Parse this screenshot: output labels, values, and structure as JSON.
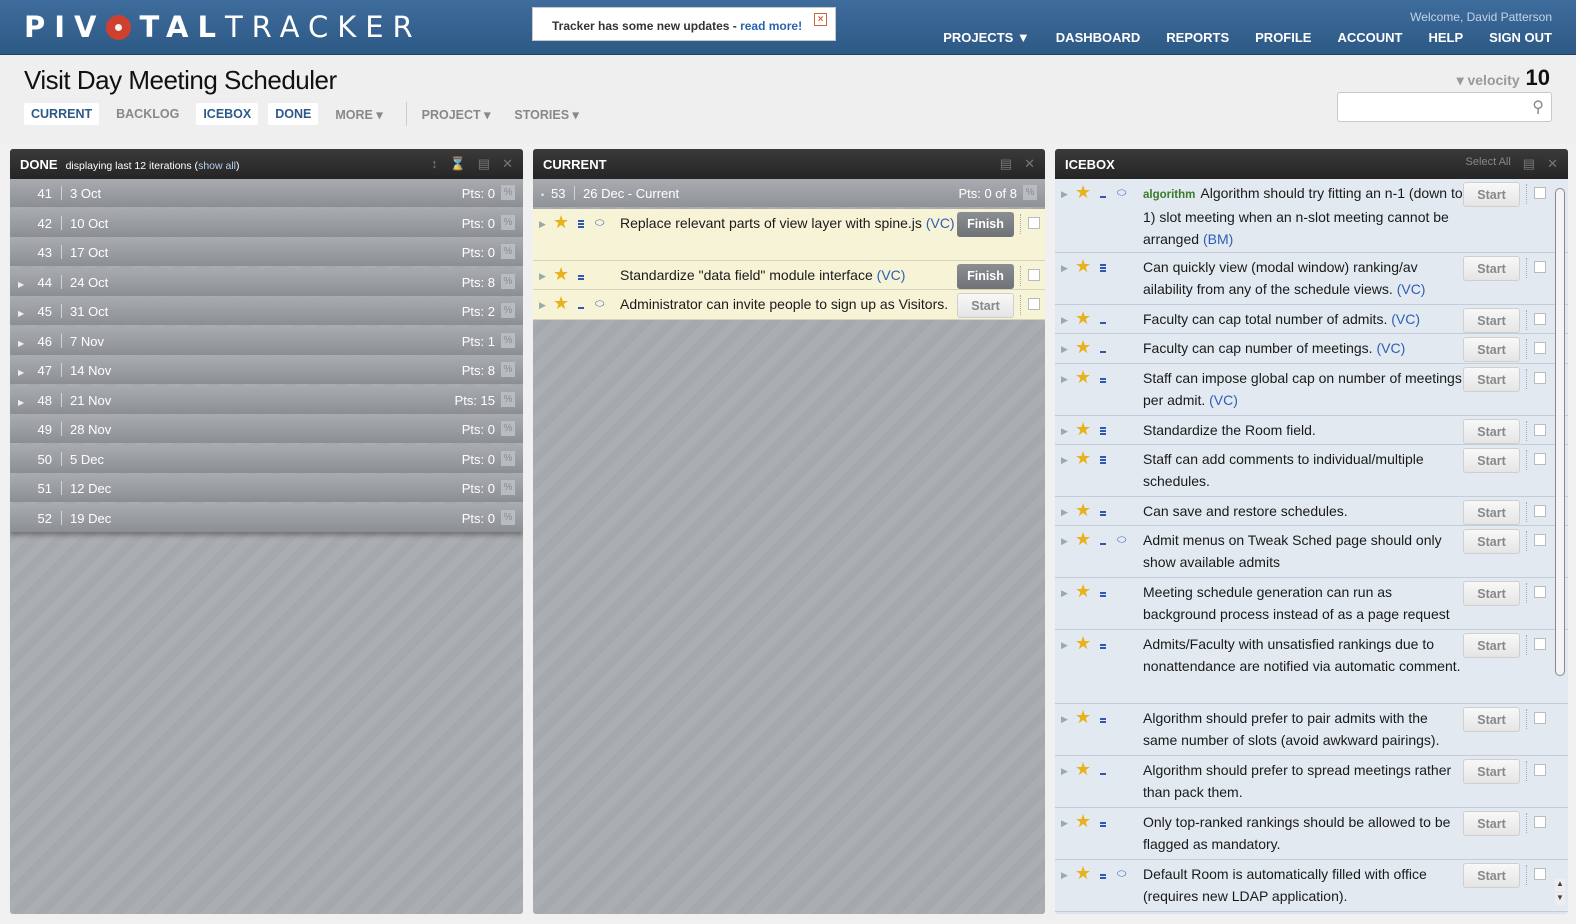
{
  "topbar": {
    "logo_part1": "PIV",
    "logo_part2": "TAL",
    "logo_part3": "TRACKER",
    "notice_text": "Tracker has some new updates - ",
    "notice_link": "read more!",
    "notice_close": "×",
    "welcome": "Welcome, David Patterson",
    "nav": [
      "PROJECTS ▼",
      "DASHBOARD",
      "REPORTS",
      "PROFILE",
      "ACCOUNT",
      "HELP",
      "SIGN OUT"
    ]
  },
  "header": {
    "title": "Visit Day Meeting Scheduler",
    "tabs": [
      "CURRENT",
      "BACKLOG",
      "ICEBOX",
      "DONE",
      "MORE ▾"
    ],
    "tabs2": [
      "PROJECT ▾",
      "STORIES ▾"
    ],
    "velocity_label": "▾ velocity",
    "velocity_value": "10"
  },
  "done": {
    "title": "DONE",
    "sub_prefix": "displaying last 12 iterations (",
    "sub_link": "show all",
    "sub_suffix": ")",
    "iterations": [
      {
        "num": "41",
        "date": "3 Oct",
        "pts": "Pts: 0",
        "expand": ""
      },
      {
        "num": "42",
        "date": "10 Oct",
        "pts": "Pts: 0",
        "expand": ""
      },
      {
        "num": "43",
        "date": "17 Oct",
        "pts": "Pts: 0",
        "expand": ""
      },
      {
        "num": "44",
        "date": "24 Oct",
        "pts": "Pts: 8",
        "expand": "▶"
      },
      {
        "num": "45",
        "date": "31 Oct",
        "pts": "Pts: 2",
        "expand": "▶"
      },
      {
        "num": "46",
        "date": "7 Nov",
        "pts": "Pts: 1",
        "expand": "▶"
      },
      {
        "num": "47",
        "date": "14 Nov",
        "pts": "Pts: 8",
        "expand": "▶"
      },
      {
        "num": "48",
        "date": "21 Nov",
        "pts": "Pts: 15",
        "expand": "▶"
      },
      {
        "num": "49",
        "date": "28 Nov",
        "pts": "Pts: 0",
        "expand": ""
      },
      {
        "num": "50",
        "date": "5 Dec",
        "pts": "Pts: 0",
        "expand": ""
      },
      {
        "num": "51",
        "date": "12 Dec",
        "pts": "Pts: 0",
        "expand": ""
      },
      {
        "num": "52",
        "date": "19 Dec",
        "pts": "Pts: 0",
        "expand": ""
      }
    ]
  },
  "current": {
    "title": "CURRENT",
    "iter_num": "53",
    "iter_date": "26 Dec - Current",
    "iter_pts": "Pts: 0 of 8",
    "stories": [
      {
        "text": "Replace relevant parts of view layer with spine.js ",
        "owner": "(VC)",
        "button": "Finish"
      },
      {
        "text": "Standardize \"data field\" module interface ",
        "owner": "(VC)",
        "button": "Finish"
      },
      {
        "text": "Administrator can invite people to sign up as Visitors.",
        "owner": "",
        "button": "Start"
      }
    ]
  },
  "icebox": {
    "title": "ICEBOX",
    "select_all": "Select All",
    "stories": [
      {
        "label": "algorithm",
        "text": "Algorithm should try fitting an n-1 (down to 1) slot meeting when an n-slot meeting cannot be arranged ",
        "owner": "(BM)",
        "button": "Start"
      },
      {
        "label": "",
        "text": "Can quickly view (modal window) ranking/av ailability from any of the schedule views. ",
        "owner": "(VC)",
        "button": "Start"
      },
      {
        "label": "",
        "text": "Faculty can cap total number of admits. ",
        "owner": "(VC)",
        "button": "Start"
      },
      {
        "label": "",
        "text": "Faculty can cap number of meetings. ",
        "owner": "(VC)",
        "button": "Start"
      },
      {
        "label": "",
        "text": "Staff can impose global cap on number of meetings per admit. ",
        "owner": "(VC)",
        "button": "Start"
      },
      {
        "label": "",
        "text": "Standardize the Room field.",
        "owner": "",
        "button": "Start"
      },
      {
        "label": "",
        "text": "Staff can add comments to individual/multiple schedules.",
        "owner": "",
        "button": "Start"
      },
      {
        "label": "",
        "text": "Can save and restore schedules.",
        "owner": "",
        "button": "Start"
      },
      {
        "label": "",
        "text": "Admit menus on Tweak Sched page should only show available admits",
        "owner": "",
        "button": "Start"
      },
      {
        "label": "",
        "text": "Meeting schedule generation can run as background process instead of as a page request",
        "owner": "",
        "button": "Start"
      },
      {
        "label": "",
        "text": "Admits/Faculty with unsatisfied rankings due to nonattendance are notified via automatic comment.",
        "owner": "",
        "button": "Start"
      },
      {
        "label": "",
        "text": "Algorithm should prefer to pair admits with the same number of slots (avoid awkward pairings).",
        "owner": "",
        "button": "Start"
      },
      {
        "label": "",
        "text": "Algorithm should prefer to spread meetings rather than pack them.",
        "owner": "",
        "button": "Start"
      },
      {
        "label": "",
        "text": "Only top-ranked rankings should be allowed to be flagged as mandatory.",
        "owner": "",
        "button": "Start"
      },
      {
        "label": "",
        "text": "Default Room is automatically filled with office (requires new LDAP application).",
        "owner": "",
        "button": "Start"
      }
    ]
  }
}
